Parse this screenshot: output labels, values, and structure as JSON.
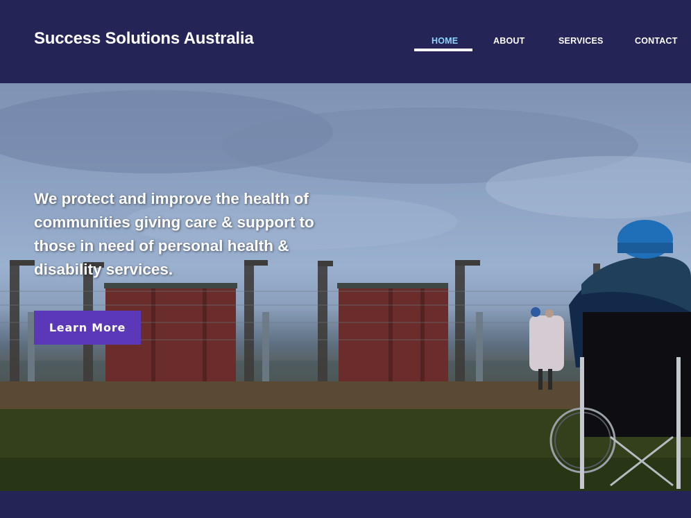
{
  "header": {
    "brand": "Success Solutions Australia"
  },
  "nav": {
    "items": [
      {
        "label": "HOME",
        "active": true
      },
      {
        "label": "ABOUT",
        "active": false
      },
      {
        "label": "SERVICES",
        "active": false
      },
      {
        "label": "CONTACT",
        "active": false
      }
    ]
  },
  "hero": {
    "headline": "We protect and improve the health of communities giving care & support to those in need of personal health & disability services.",
    "cta_label": "Learn More"
  },
  "colors": {
    "header_bg": "#252457",
    "nav_active": "#8fd3ff",
    "cta_bg": "#5a38b8"
  }
}
